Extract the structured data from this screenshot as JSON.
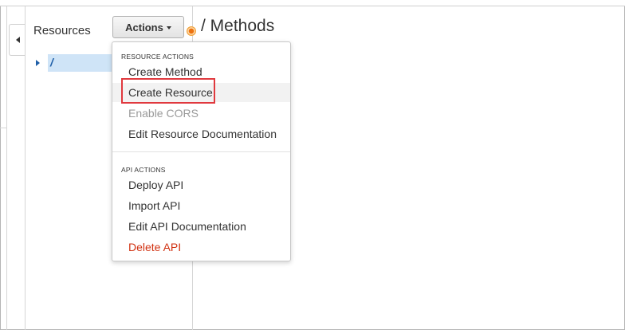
{
  "left_panel": {
    "title": "Resources"
  },
  "toolbar": {
    "actions_label": "Actions"
  },
  "page": {
    "title": "/ Methods"
  },
  "tree": {
    "root_label": "/"
  },
  "actions_menu": {
    "resource_header": "RESOURCE ACTIONS",
    "resource_items": [
      {
        "label": "Create Method",
        "state": "enabled"
      },
      {
        "label": "Create Resource",
        "state": "hover"
      },
      {
        "label": "Enable CORS",
        "state": "disabled"
      },
      {
        "label": "Edit Resource Documentation",
        "state": "enabled"
      }
    ],
    "api_header": "API ACTIONS",
    "api_items": [
      {
        "label": "Deploy API",
        "state": "enabled"
      },
      {
        "label": "Import API",
        "state": "enabled"
      },
      {
        "label": "Edit API Documentation",
        "state": "enabled"
      },
      {
        "label": "Delete API",
        "state": "danger"
      }
    ]
  },
  "colors": {
    "selection": "#cfe4f7",
    "link": "#1f5fa8",
    "danger": "#d13212",
    "highlight": "#e0393e",
    "info_dot": "#ec7211"
  },
  "icons": {
    "collapse": "caret-left-icon",
    "dropdown": "caret-down-icon",
    "tree_expand": "caret-right-icon",
    "info": "info-dot-icon"
  }
}
